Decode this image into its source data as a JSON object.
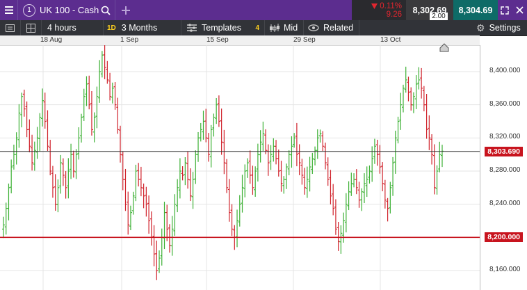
{
  "topbar": {
    "menu_icon": "hamburger-icon",
    "market_number": "1",
    "market_name": "UK 100 - Cash",
    "search_icon": "search-icon",
    "add_icon": "plus-icon",
    "change_pct": "0.11%",
    "change_abs": "9.26",
    "sell_price": "8,302.69",
    "buy_price": "8,304.69",
    "spread": "2.00",
    "expand_icon": "expand-icon",
    "close_icon": "close-icon"
  },
  "toolbar": {
    "interval": "4 hours",
    "period_badge": "1D",
    "period": "3 Months",
    "templates": "Templates",
    "templates_count": "4",
    "price_type": "Mid",
    "related": "Related",
    "settings": "Settings"
  },
  "colors": {
    "up": "#3cb034",
    "down": "#d0222b",
    "accent": "#5c2d8f",
    "price_tag": "#c8141e"
  },
  "dates": [
    "18 Aug",
    "1 Sep",
    "15 Sep",
    "29 Sep",
    "13 Oct"
  ],
  "chart_data": {
    "type": "ohlc",
    "ylim": [
      8140,
      8440
    ],
    "y_ticks": [
      "8,400.000",
      "8,360.000",
      "8,320.000",
      "8,280.000",
      "8,240.000",
      "8,200.000",
      "8,160.000"
    ],
    "y_tick_values": [
      8400,
      8360,
      8320,
      8280,
      8240,
      8200,
      8160
    ],
    "current_price": 8303.69,
    "current_price_label": "8,303.690",
    "alert_line": 8200,
    "alert_line_label": "8,200.000",
    "close_path": [
      8215,
      8235,
      8260,
      8285,
      8300,
      8320,
      8350,
      8370,
      8355,
      8330,
      8310,
      8290,
      8305,
      8320,
      8345,
      8365,
      8340,
      8310,
      8280,
      8260,
      8240,
      8260,
      8290,
      8275,
      8260,
      8280,
      8300,
      8280,
      8300,
      8320,
      8345,
      8370,
      8385,
      8360,
      8330,
      8345,
      8370,
      8400,
      8420,
      8405,
      8390,
      8370,
      8380,
      8360,
      8330,
      8300,
      8270,
      8240,
      8215,
      8230,
      8250,
      8280,
      8270,
      8260,
      8250,
      8240,
      8220,
      8200,
      8180,
      8160,
      8175,
      8200,
      8230,
      8210,
      8190,
      8210,
      8240,
      8260,
      8280,
      8275,
      8290,
      8270,
      8250,
      8270,
      8300,
      8320,
      8330,
      8340,
      8320,
      8300,
      8330,
      8345,
      8360,
      8340,
      8315,
      8290,
      8260,
      8230,
      8210,
      8200,
      8220,
      8240,
      8260,
      8280,
      8290,
      8275,
      8260,
      8280,
      8300,
      8315,
      8325,
      8305,
      8290,
      8300,
      8310,
      8295,
      8280,
      8265,
      8270,
      8285,
      8300,
      8310,
      8320,
      8300,
      8290,
      8275,
      8260,
      8270,
      8285,
      8295,
      8305,
      8320,
      8325,
      8310,
      8290,
      8270,
      8250,
      8235,
      8210,
      8195,
      8205,
      8220,
      8240,
      8255,
      8265,
      8270,
      8260,
      8245,
      8255,
      8265,
      8270,
      8280,
      8295,
      8310,
      8300,
      8285,
      8265,
      8245,
      8235,
      8260,
      8290,
      8320,
      8340,
      8360,
      8380,
      8390,
      8375,
      8360,
      8370,
      8385,
      8390,
      8380,
      8360,
      8330,
      8320,
      8300,
      8260,
      8280,
      8300,
      8304
    ]
  }
}
